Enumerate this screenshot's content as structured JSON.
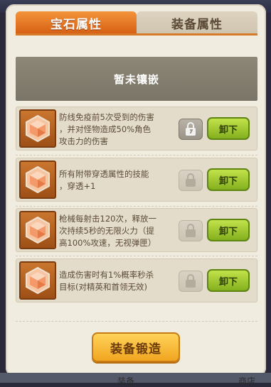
{
  "tabs": [
    {
      "label": "宝石属性",
      "active": true
    },
    {
      "label": "装备属性",
      "active": false
    }
  ],
  "header": {
    "label": "暂未镶嵌"
  },
  "gems": [
    {
      "lines": [
        "防线免疫前5次受到的伤害",
        "，并对怪物造成50%角色",
        "攻击力的伤害"
      ],
      "lock_state": "active",
      "button": "卸下"
    },
    {
      "lines": [
        "所有附带穿透属性的技能",
        "，穿透+1"
      ],
      "lock_state": "inactive",
      "button": "卸下"
    },
    {
      "lines": [
        "枪械每射击120次，释放一",
        "次持续5秒的无限火力（提",
        "高100%攻速，无视弹匣）"
      ],
      "lock_state": "inactive",
      "button": "卸下"
    },
    {
      "lines": [
        "造成伤害时有1%概率秒杀",
        "目标(对精英和首领无效)"
      ],
      "lock_state": "inactive",
      "button": "卸下"
    }
  ],
  "forge_button": "装备锻造",
  "footer": {
    "left": "装备",
    "right": "商店"
  },
  "colors": {
    "accent": "#e07a24",
    "button_green": "#9ccb2e",
    "forge": "#f6b42f",
    "panel": "#f1ece0"
  },
  "icons": {
    "gem": "hexagon-gem-icon",
    "lock": "lock-icon"
  }
}
